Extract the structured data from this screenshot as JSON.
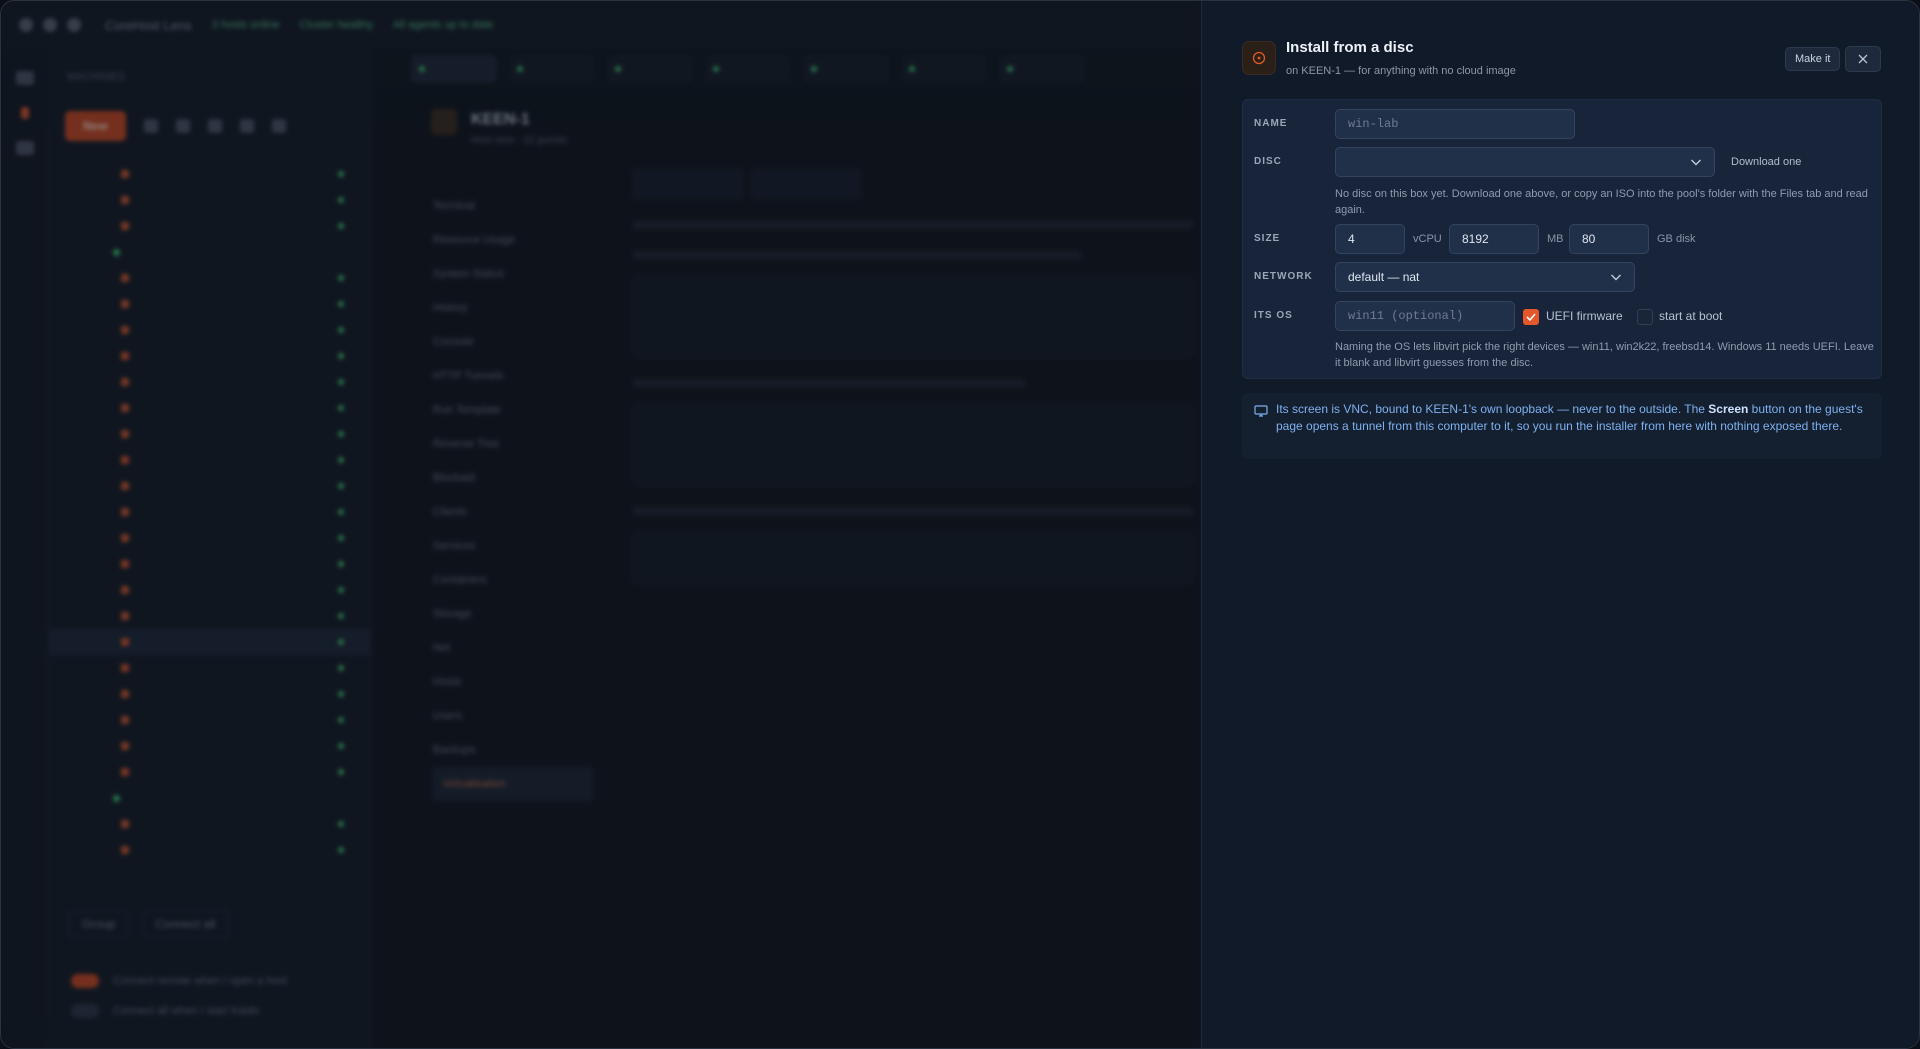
{
  "backdrop": {
    "app_title": "CoreHost Lens",
    "title_chips": [
      "3 hosts online",
      "Cluster healthy",
      "All agents up to date"
    ],
    "sidebar_heading": "MACHINES",
    "new_label": "New",
    "vm_title": "KEEN-1",
    "vm_subtitle": "Host view · 12 guests",
    "nav_items": [
      "Terminal",
      "Resource Usage",
      "System Status",
      "History",
      "Console",
      "HTTP Tunnels",
      "Run Template",
      "Reverse Tree",
      "Blockaid",
      "Clients",
      "Services",
      "Containers",
      "Storage",
      "Net",
      "Hosts",
      "Users",
      "Backups",
      "Virtualisation"
    ],
    "group_label": "Group",
    "connect_label": "Connect all",
    "toggle1": "Connect remote when I open a host",
    "toggle2": "Connect all when I start Kaido"
  },
  "drawer": {
    "title": "Install from a disc",
    "subtitle": "on KEEN-1 — for anything with no cloud image",
    "make_label": "Make it",
    "close_icon": "close-icon",
    "accent": "#e3572b",
    "name": {
      "label": "NAME",
      "placeholder": "win-lab"
    },
    "disc": {
      "label": "DISC",
      "value": "",
      "download_link": "Download one",
      "help": "No disc on this box yet. Download one above, or copy an ISO into the pool's folder with the Files tab and read again."
    },
    "size": {
      "label": "SIZE",
      "vcpu": "4",
      "vcpu_unit": "vCPU",
      "memory": "8192",
      "memory_unit": "MB",
      "disk": "80",
      "disk_unit": "GB disk"
    },
    "network": {
      "label": "NETWORK",
      "value": "default — nat"
    },
    "os": {
      "label": "ITS OS",
      "placeholder": "win11 (optional)",
      "uefi_label": "UEFI firmware",
      "uefi_checked": true,
      "boot_label": "start at boot",
      "boot_checked": false,
      "help": "Naming the OS lets libvirt pick the right devices — win11, win2k22, freebsd14. Windows 11 needs UEFI. Leave it blank and libvirt guesses from the disc."
    },
    "info": {
      "text_before": "Its screen is VNC, bound to KEEN-1's own loopback — never to the outside. The ",
      "strong": "Screen",
      "text_after": " button on the guest's page opens a tunnel from this computer to it, so you run the installer from here with nothing exposed there."
    }
  }
}
